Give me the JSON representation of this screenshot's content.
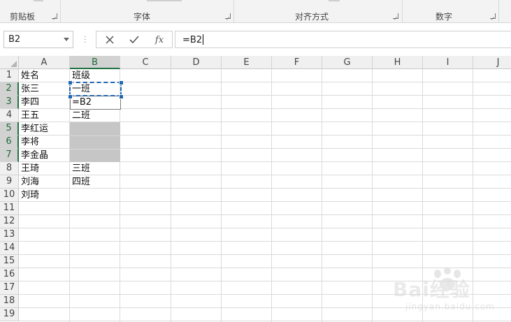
{
  "ribbon": {
    "groups": [
      {
        "label": "剪贴板"
      },
      {
        "label": "字体"
      },
      {
        "label": "对齐方式"
      },
      {
        "label": "数字"
      }
    ]
  },
  "formula_bar": {
    "name_box": "B2",
    "formula": "=B2",
    "cancel_icon": "close-icon",
    "enter_icon": "check-icon",
    "fx_label": "fx"
  },
  "sheet": {
    "columns": [
      "A",
      "B",
      "C",
      "D",
      "E",
      "F",
      "G",
      "H",
      "I",
      "J"
    ],
    "rows": [
      "1",
      "2",
      "3",
      "4",
      "5",
      "6",
      "7",
      "8",
      "9",
      "10",
      "11",
      "12",
      "13",
      "14",
      "15",
      "16",
      "17",
      "18",
      "19"
    ],
    "column_a": [
      "姓名",
      "张三",
      "李四",
      "王五",
      "李红运",
      "李将",
      "李金晶",
      "王琦",
      "刘海",
      "刘琦"
    ],
    "column_b": {
      "b1": "班级",
      "b2": "一班",
      "b3": "=B2",
      "b4": "二班",
      "b8": "三班",
      "b9": "四班"
    },
    "active_cell": "B3",
    "copy_source": "B2",
    "selected_column": "B"
  },
  "watermark": {
    "text": "Bai经验",
    "sub": "jingyan.baidu.com"
  },
  "colors": {
    "accent_green": "#217346",
    "marquee_blue": "#1f66b0",
    "gray_fill": "#c6c6c6"
  }
}
